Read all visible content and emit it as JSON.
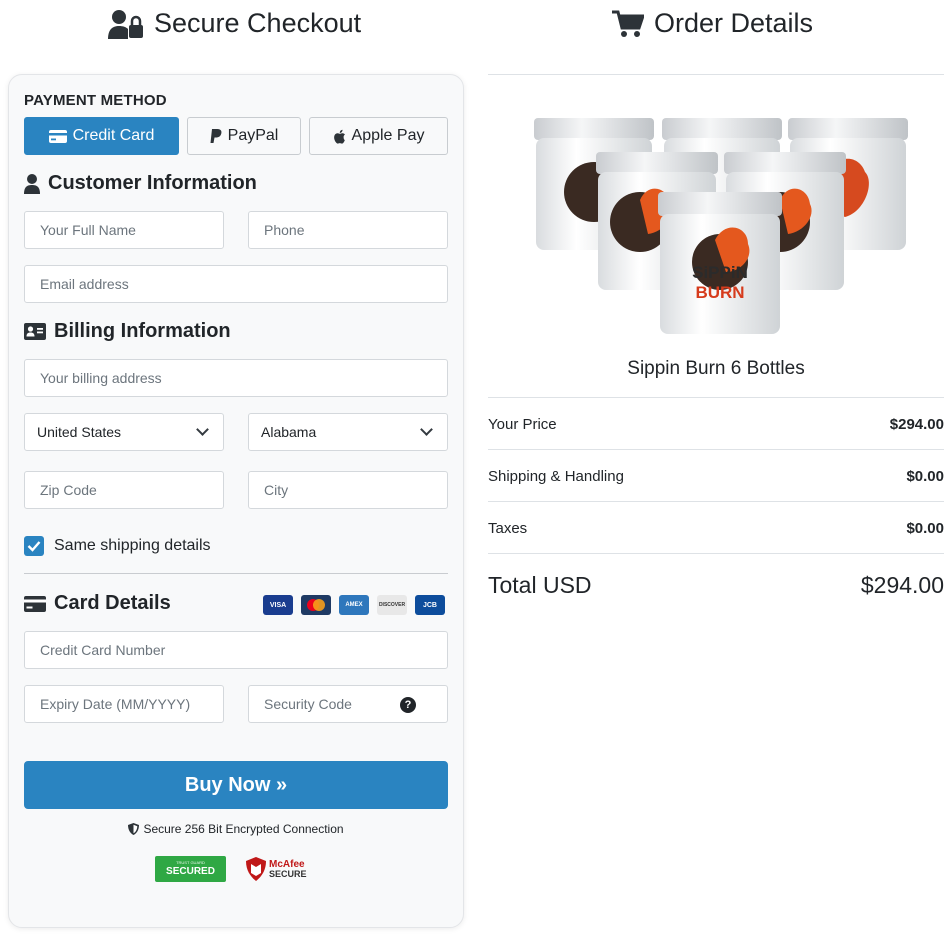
{
  "left_header": {
    "title": "Secure Checkout",
    "icon": "user-lock-icon"
  },
  "right_header": {
    "title": "Order Details",
    "icon": "shopping-cart-icon"
  },
  "payment": {
    "label": "PAYMENT METHOD",
    "methods": [
      {
        "label": "Credit Card",
        "icon": "credit-card-icon",
        "active": true
      },
      {
        "label": "PayPal",
        "icon": "paypal-icon",
        "active": false
      },
      {
        "label": "Apple Pay",
        "icon": "apple-icon",
        "active": false
      }
    ]
  },
  "customer": {
    "title": "Customer Information",
    "name_placeholder": "Your Full Name",
    "phone_placeholder": "Phone",
    "email_placeholder": "Email address"
  },
  "billing": {
    "title": "Billing Information",
    "address_placeholder": "Your billing address",
    "country": "United States",
    "state": "Alabama",
    "zip_placeholder": "Zip Code",
    "city_placeholder": "City",
    "same_shipping_label": "Same shipping details",
    "same_shipping_checked": true
  },
  "card": {
    "title": "Card Details",
    "number_placeholder": "Credit Card Number",
    "expiry_placeholder": "Expiry Date (MM/YYYY)",
    "cvv_placeholder": "Security Code",
    "brands": [
      {
        "name": "visa",
        "label": "VISA",
        "color": "#1a3d8f"
      },
      {
        "name": "mastercard",
        "label": "",
        "color": "#1f3a64"
      },
      {
        "name": "amex",
        "label": "AMEX",
        "color": "#2e77bc"
      },
      {
        "name": "discover",
        "label": "DISCOVER",
        "color": "#e8e8e8"
      },
      {
        "name": "jcb",
        "label": "JCB",
        "color": "#0d4d9c"
      }
    ]
  },
  "buy_button": "Buy Now »",
  "secure_note": "Secure 256 Bit Encrypted Connection",
  "badges": {
    "trust_top": "TRUST GUARD",
    "trust_main": "SECURED",
    "mcafee_top": "McAfee",
    "mcafee_bottom": "SECURE"
  },
  "order": {
    "product_name": "Sippin Burn 6 Bottles",
    "product_jar_text_top": "SiPPiN",
    "product_jar_text_bottom": "BURN",
    "rows": [
      {
        "label": "Your Price",
        "value": "$294.00"
      },
      {
        "label": "Shipping & Handling",
        "value": "$0.00"
      },
      {
        "label": "Taxes",
        "value": "$0.00"
      }
    ],
    "total_label": "Total USD",
    "total_value": "$294.00"
  },
  "colors": {
    "accent": "#2a84c1",
    "panel_bg": "#f8f9fa",
    "trust_green": "#2fa844",
    "mcafee_red": "#c01818"
  }
}
